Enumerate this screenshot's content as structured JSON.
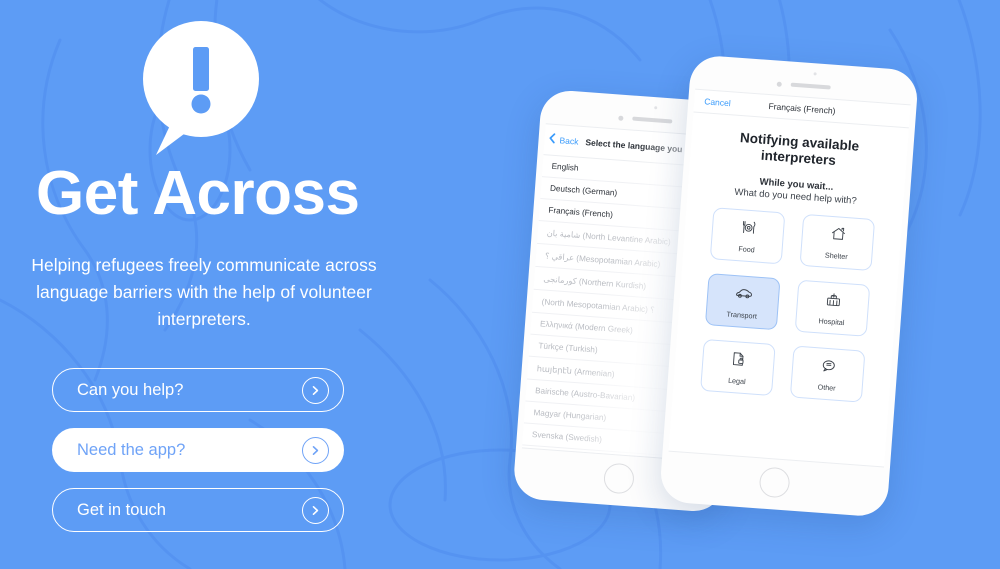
{
  "theme": {
    "background": "#5d9cf5",
    "accent": "#ffffff",
    "button_text_blue": "#6fa3f7",
    "ios_blue": "#3a9bfb",
    "selected_card_fill": "#d6e4fb"
  },
  "hero": {
    "logo_icon": "exclamation-speech-bubble-icon",
    "title": "Get Across",
    "subtitle": "Helping refugees freely communicate across language barriers with the help of volunteer interpreters.",
    "buttons": [
      {
        "label": "Can you help?",
        "style": "outline",
        "icon": "chevron-right-circle-icon"
      },
      {
        "label": "Need the app?",
        "style": "filled",
        "icon": "chevron-right-circle-icon"
      },
      {
        "label": "Get in touch",
        "style": "outline",
        "icon": "chevron-right-circle-icon"
      }
    ]
  },
  "phone_back": {
    "nav": {
      "back_icon": "chevron-left-icon",
      "back_label": "Back",
      "title": "Select the language you ne"
    },
    "languages": [
      {
        "name": "English",
        "faded": false
      },
      {
        "name": "Deutsch (German)",
        "faded": false
      },
      {
        "name": "Français (French)",
        "faded": false
      },
      {
        "name": "شامية بان (North Levantine Arabic)",
        "faded": true
      },
      {
        "name": "عراقي ؟ (Mesopotamian Arabic)",
        "faded": true
      },
      {
        "name": "کورمانجی (Northern Kurdish)",
        "faded": true
      },
      {
        "name": "(North Mesopotamian Arabic) ؟",
        "faded": true
      },
      {
        "name": "Ελληνικά (Modern Greek)",
        "faded": true
      },
      {
        "name": "Türkçe (Turkish)",
        "faded": true
      },
      {
        "name": "հայերէն (Armenian)",
        "faded": true
      },
      {
        "name": "Bairische (Austro-Bavarian)",
        "faded": true
      },
      {
        "name": "Magyar (Hungarian)",
        "faded": true
      },
      {
        "name": "Svenska (Swedish)",
        "faded": true
      }
    ]
  },
  "phone_front": {
    "nav": {
      "cancel_label": "Cancel",
      "title": "Français (French)"
    },
    "heading": "Notifying available interpreters",
    "wait_heading": "While you wait...",
    "wait_subheading": "What do you need help with?",
    "options": [
      {
        "label": "Food",
        "icon": "cutlery-plate-icon",
        "selected": false
      },
      {
        "label": "Shelter",
        "icon": "house-icon",
        "selected": false
      },
      {
        "label": "Transport",
        "icon": "car-icon",
        "selected": true
      },
      {
        "label": "Hospital",
        "icon": "hospital-icon",
        "selected": false
      },
      {
        "label": "Legal",
        "icon": "document-lock-icon",
        "selected": false
      },
      {
        "label": "Other",
        "icon": "speech-bubble-icon",
        "selected": false
      }
    ]
  }
}
